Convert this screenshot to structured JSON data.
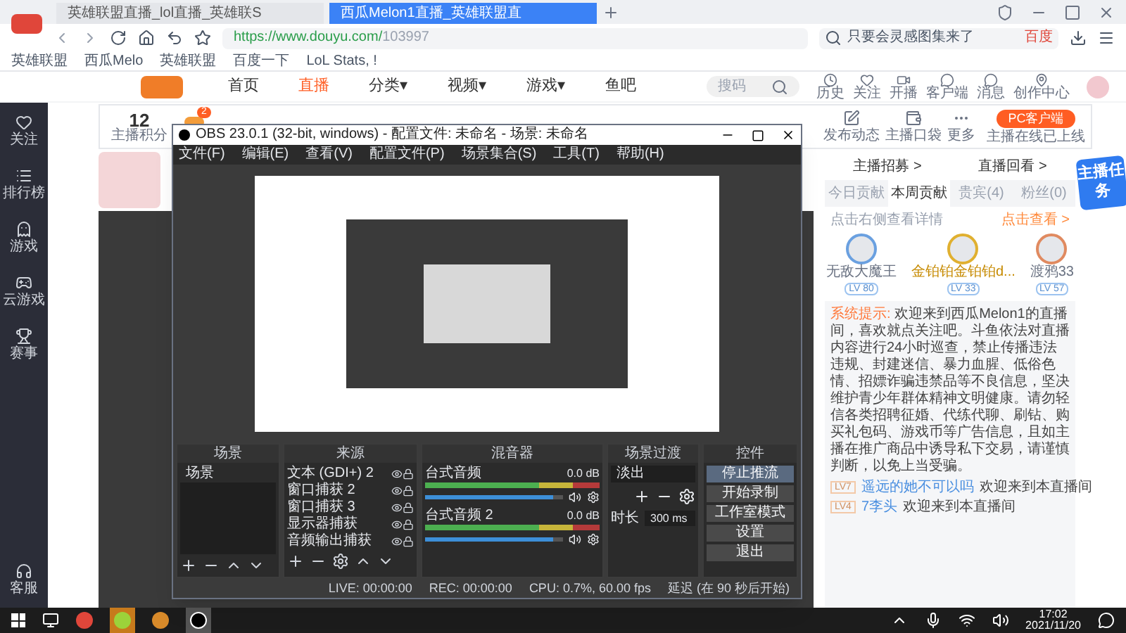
{
  "browser": {
    "tabs": [
      {
        "title": "英雄联盟直播_lol直播_英雄联S",
        "selected": false
      },
      {
        "title": "西瓜Melon1直播_英雄联盟直",
        "selected": true
      }
    ],
    "url_host": "https://www.douyu.com/",
    "url_path": "103997",
    "search_placeholder": "只要会灵感图集来了",
    "search_engine": "百度",
    "bookmarks": [
      "英雄联盟",
      "西瓜Melo",
      "英雄联盟",
      "百度一下",
      "LoL Stats, !"
    ]
  },
  "site": {
    "nav": [
      {
        "label": "首页",
        "selected": false,
        "dropdown": false
      },
      {
        "label": "直播",
        "selected": true,
        "dropdown": false
      },
      {
        "label": "分类",
        "selected": false,
        "dropdown": true
      },
      {
        "label": "视频",
        "selected": false,
        "dropdown": true
      },
      {
        "label": "游戏",
        "selected": false,
        "dropdown": true
      },
      {
        "label": "鱼吧",
        "selected": false,
        "dropdown": false
      }
    ],
    "dropdown_mark": "▾",
    "search_placeholder": "搜码",
    "header_links": [
      "历史",
      "关注",
      "开播",
      "客户端",
      "消息",
      "创作中心"
    ]
  },
  "sidebar": [
    "关注",
    "排行榜",
    "游戏",
    "云游戏",
    "赛事"
  ],
  "sidebar_bottom": "客服",
  "toolbar": {
    "score": "12",
    "score_label": "主播积分",
    "badge": "2",
    "items": [
      "发布动态",
      "主播口袋",
      "更多"
    ],
    "client_button": "PC客户端",
    "client_note": "主播在线已上线"
  },
  "obs": {
    "title": "OBS 23.0.1 (32-bit, windows) - 配置文件: 未命名 - 场景: 未命名",
    "menu": [
      "文件(F)",
      "编辑(E)",
      "查看(V)",
      "配置文件(P)",
      "场景集合(S)",
      "工具(T)",
      "帮助(H)"
    ],
    "docks": {
      "scenes": "场景",
      "sources": "来源",
      "mixer": "混音器",
      "transitions": "场景过渡",
      "controls": "控件"
    },
    "scenes": [
      {
        "name": "场景",
        "selected": false
      }
    ],
    "sources": [
      "文本 (GDI+) 2",
      "窗口捕获 2",
      "窗口捕获 3",
      "显示器捕获",
      "音频输出捕获"
    ],
    "mixer": [
      {
        "name": "台式音频",
        "reading": "0.0 dB",
        "level": 0.93
      },
      {
        "name": "台式音频 2",
        "reading": "0.0 dB",
        "level": 0.93
      }
    ],
    "transition": {
      "value": "淡出",
      "duration_label": "时长",
      "duration": "300 ms"
    },
    "controls": [
      {
        "label": "停止推流",
        "selected": true
      },
      {
        "label": "开始录制",
        "selected": false
      },
      {
        "label": "工作室模式",
        "selected": false
      },
      {
        "label": "设置",
        "selected": false
      },
      {
        "label": "退出",
        "selected": false
      }
    ],
    "status": [
      "LIVE: 00:00:00",
      "REC: 00:00:00",
      "CPU: 0.7%, 60.00 fps",
      "延迟 (在 90 秒后开始)"
    ]
  },
  "room": {
    "links": [
      "主播招募 >",
      "直播回看 >"
    ],
    "tabs": [
      {
        "label": "今日贡献",
        "selected": false
      },
      {
        "label": "本周贡献",
        "selected": true
      },
      {
        "label": "贵宾(4)",
        "selected": false
      },
      {
        "label": "粉丝(0)",
        "selected": false
      }
    ],
    "hint": "点击右侧查看详情",
    "more": "点击查看 >",
    "top3": [
      {
        "name": "无敌大魔王",
        "level": "LV 80",
        "color": "#6aa0e0"
      },
      {
        "name": "金铂铂金铂铂d...",
        "level": "LV 33",
        "color": "#e0b030"
      },
      {
        "name": "渡鸦33",
        "level": "LV 57",
        "color": "#e08a60"
      }
    ],
    "chat": [
      {
        "kind": "system",
        "tag": "系统提示:",
        "text": "欢迎来到西瓜Melon1的直播间，喜欢就点关注吧。斗鱼依法对直播内容进行24小时巡查，禁止传播违法违规、封建迷信、暴力血腥、低俗色情、招嫖诈骗违禁品等不良信息，坚决维护青少年群体精神文明健康。请勿轻信各类招聘征婚、代练代聊、刷钻、购买礼包码、游戏币等广告信息，且如主播在推广商品中诱导私下交易，请谨慎判断，以免上当受骗。"
      },
      {
        "kind": "user",
        "level": "LV7",
        "user": "遥远的她不可以吗",
        "text": "欢迎来到本直播间"
      },
      {
        "kind": "user",
        "level": "LV4",
        "user": "7李头",
        "text": "欢迎来到本直播间"
      }
    ]
  },
  "task_banner": "主播任务",
  "taskbar": {
    "time": "17:02",
    "date": "2021/11/20"
  }
}
